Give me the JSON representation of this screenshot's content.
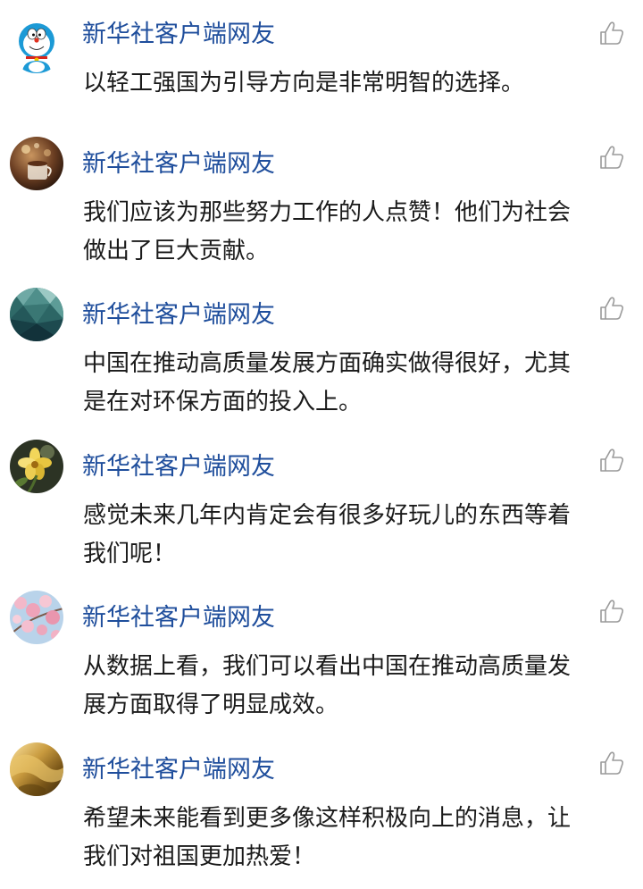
{
  "comments": [
    {
      "user": "新华社客户端网友",
      "text": "以轻工强国为引导方向是非常明智的选择。",
      "avatar": "doraemon-avatar"
    },
    {
      "user": "新华社客户端网友",
      "text": "我们应该为那些努力工作的人点赞！他们为社会做出了巨大贡献。",
      "avatar": "coffee-bokeh-avatar"
    },
    {
      "user": "新华社客户端网友",
      "text": "中国在推动高质量发展方面确实做得很好，尤其是在对环保方面的投入上。",
      "avatar": "teal-polygon-avatar"
    },
    {
      "user": "新华社客户端网友",
      "text": "感觉未来几年内肯定会有很多好玩儿的东西等着我们呢！",
      "avatar": "yellow-flower-avatar"
    },
    {
      "user": "新华社客户端网友",
      "text": "从数据上看，我们可以看出中国在推动高质量发展方面取得了明显成效。",
      "avatar": "cherry-blossom-avatar"
    },
    {
      "user": "新华社客户端网友",
      "text": "希望未来能看到更多像这样积极向上的消息，让我们对祖国更加热爱！",
      "avatar": "gold-fabric-avatar"
    }
  ],
  "like_icon": "thumbs-up-icon"
}
